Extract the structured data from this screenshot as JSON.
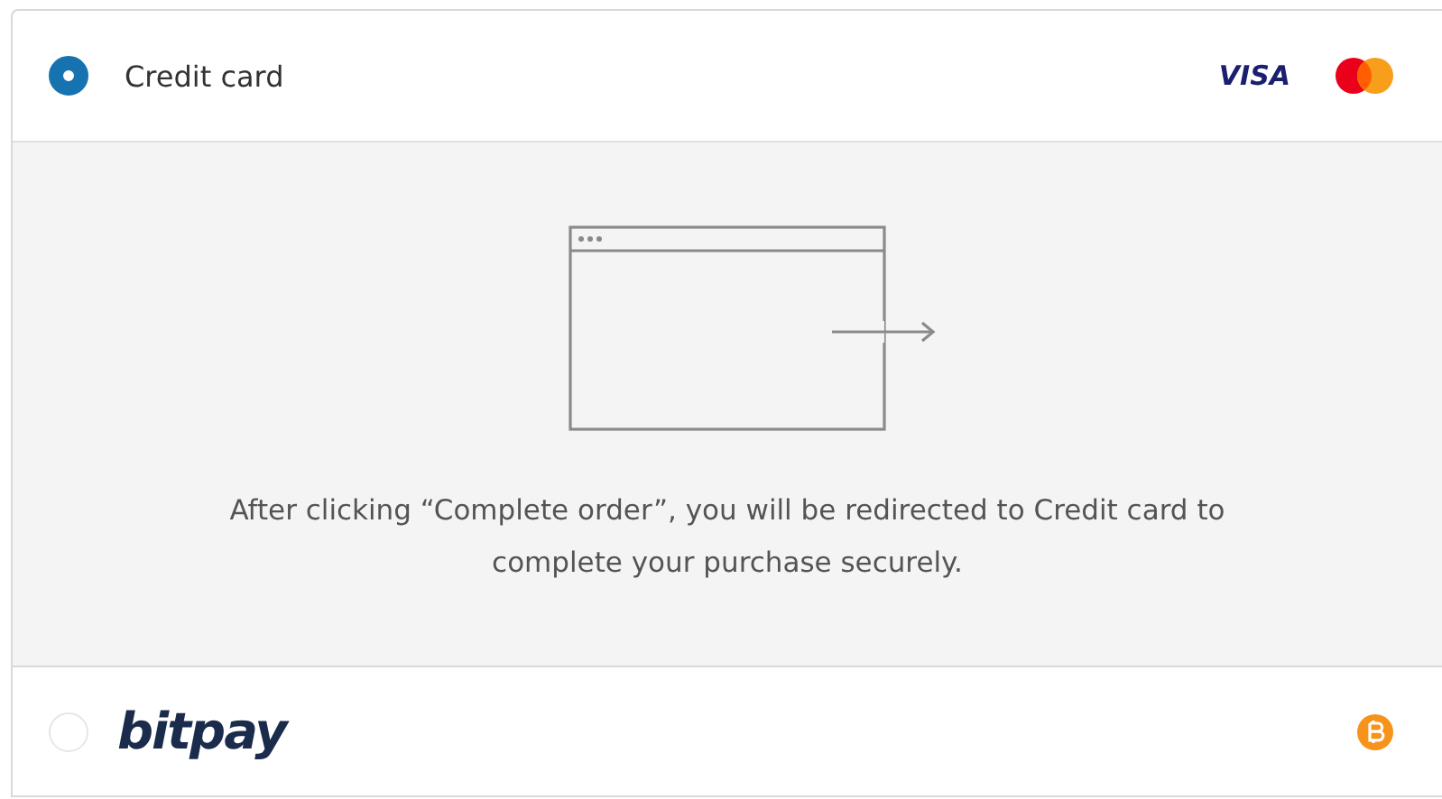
{
  "payment_methods": [
    {
      "kind": "card",
      "label": "Credit card",
      "selected": true,
      "brands": [
        "VISA"
      ],
      "redirect_notice": "After clicking “Complete order”, you will be redirected to Credit card to complete your purchase securely."
    },
    {
      "kind": "bitpay",
      "label": "bitpay",
      "selected": false
    }
  ]
}
